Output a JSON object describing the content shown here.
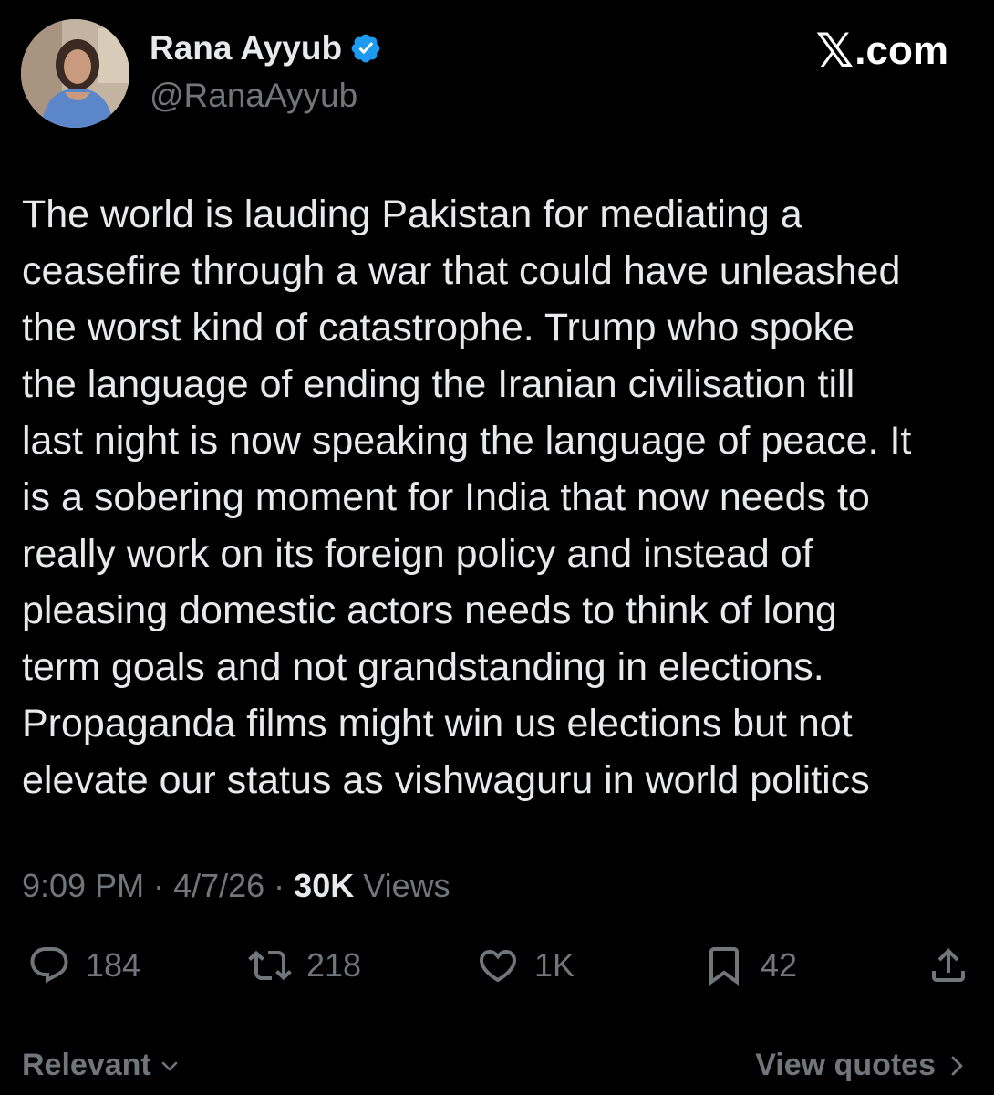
{
  "author": {
    "display_name": "Rana Ayyub",
    "handle": "@RanaAyyub",
    "verified": true
  },
  "brand": {
    "x_glyph": "𝕏",
    "text": ".com"
  },
  "tweet": {
    "lines": [
      "The world is lauding Pakistan for mediating a",
      "ceasefire through a war that could have unleashed",
      "the worst kind of catastrophe. Trump who spoke",
      "the language of ending the Iranian civilisation till",
      "last night is now speaking the language of peace. It",
      "is a sobering moment for India that now needs to",
      "really work on its foreign policy and instead of",
      "pleasing domestic actors needs to think of long",
      "term goals and not grandstanding in elections.",
      "Propaganda films might win us elections but not",
      "elevate our status as vishwaguru in world politics"
    ]
  },
  "meta": {
    "time": "9:09 PM",
    "separator": " · ",
    "date": "4/7/26",
    "views_count": "30K",
    "views_label": " Views"
  },
  "actions": {
    "replies": "184",
    "reposts": "218",
    "likes": "1K",
    "bookmarks": "42"
  },
  "footer": {
    "sort_label": "Relevant",
    "view_quotes_label": "View quotes"
  },
  "colors": {
    "background": "#000000",
    "primary_text": "#e7e9ea",
    "secondary_text": "#71767b",
    "verified_badge": "#1d9bf0"
  }
}
